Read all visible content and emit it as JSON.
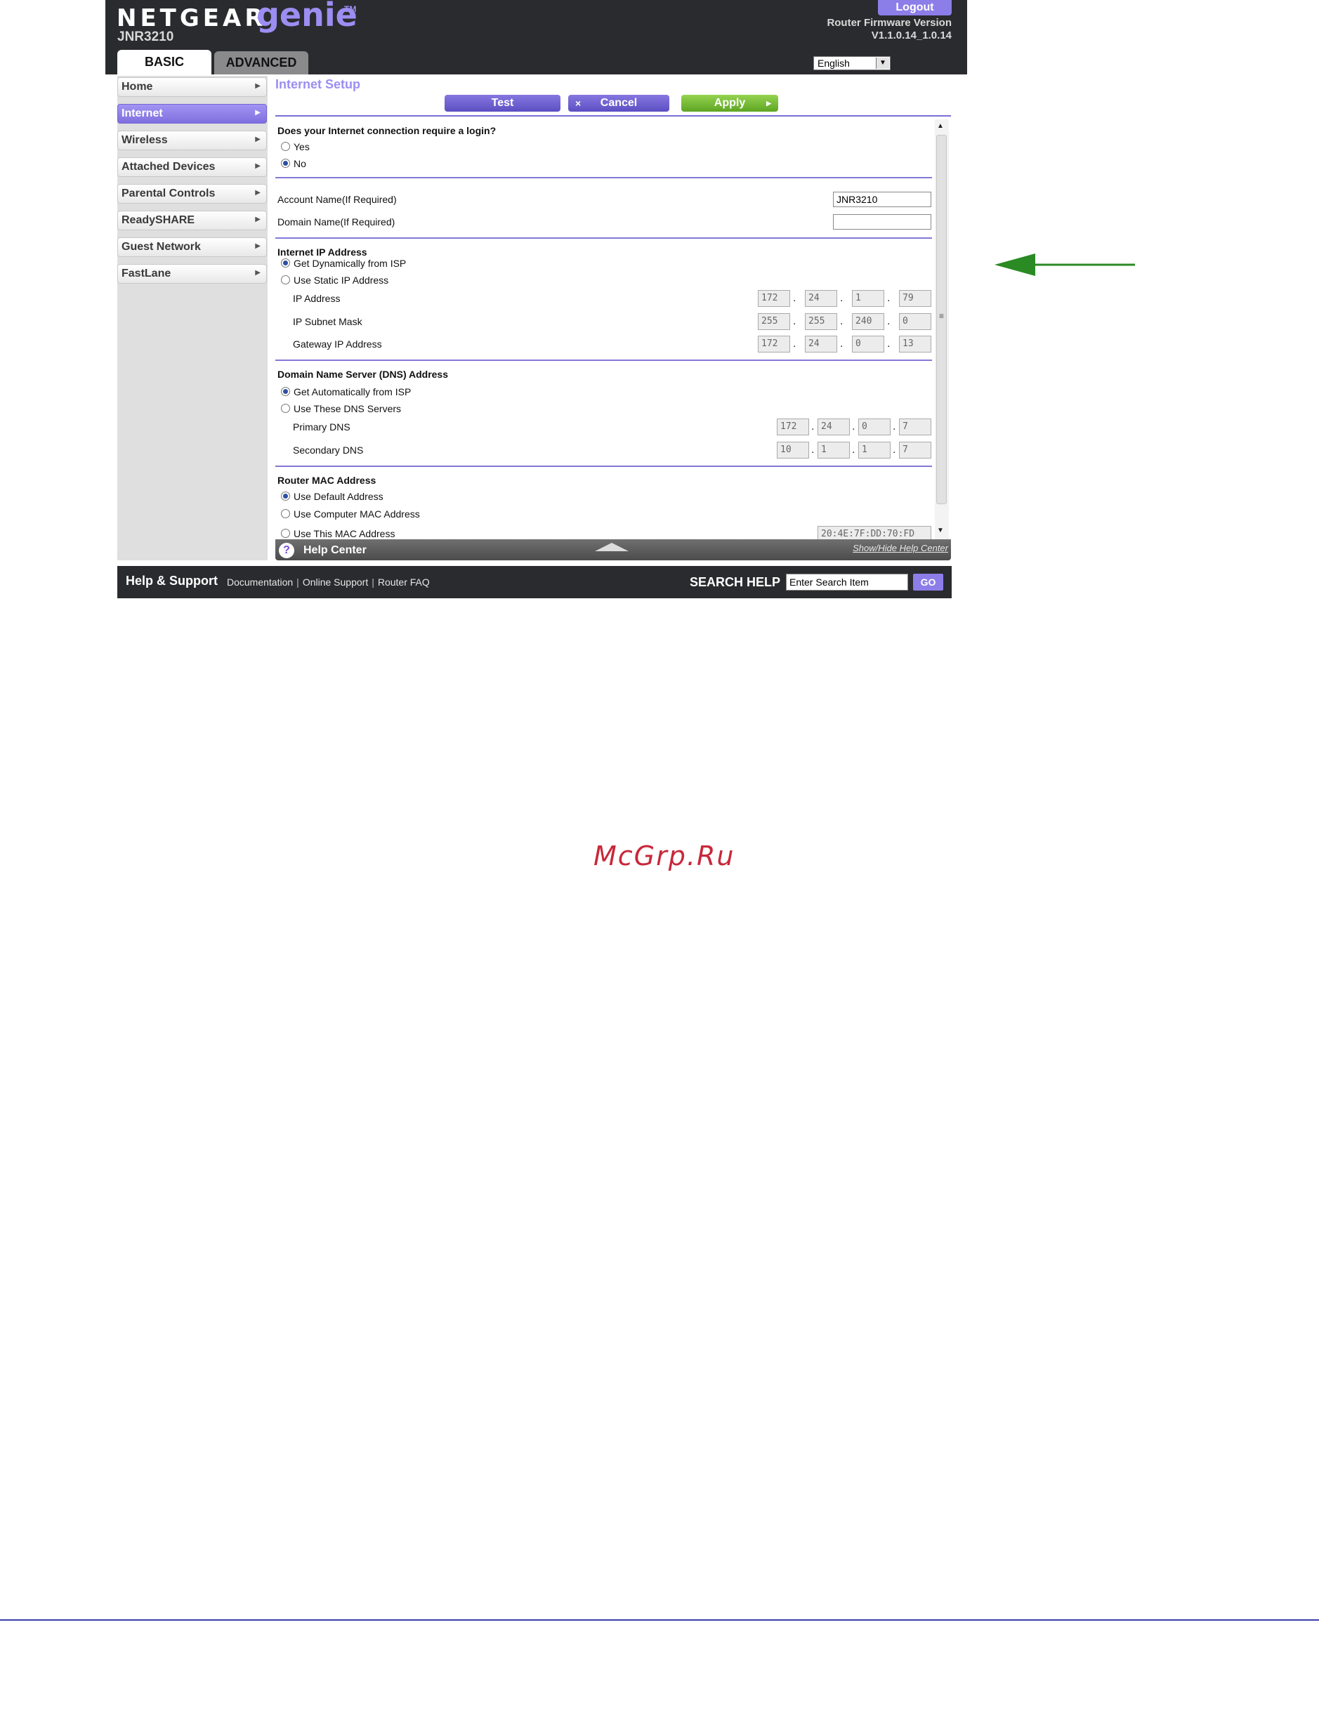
{
  "header": {
    "brand": "NETGEAR",
    "product": "genie",
    "tm": "TM",
    "model": "JNR3210",
    "logout_label": "Logout",
    "firmware_label": "Router Firmware Version",
    "firmware_version": "V1.1.0.14_1.0.14",
    "language": "English",
    "tabs": [
      {
        "label": "BASIC",
        "active": true
      },
      {
        "label": "ADVANCED",
        "active": false
      }
    ]
  },
  "sidebar": {
    "items": [
      {
        "label": "Home",
        "active": false
      },
      {
        "label": "Internet",
        "active": true
      },
      {
        "label": "Wireless",
        "active": false
      },
      {
        "label": "Attached Devices",
        "active": false
      },
      {
        "label": "Parental Controls",
        "active": false
      },
      {
        "label": "ReadySHARE",
        "active": false
      },
      {
        "label": "Guest Network",
        "active": false
      },
      {
        "label": "FastLane",
        "active": false
      }
    ]
  },
  "main": {
    "title": "Internet Setup",
    "buttons": {
      "test": "Test",
      "cancel": "Cancel",
      "apply": "Apply",
      "cancel_icon": "×",
      "apply_icon": "▶"
    },
    "login": {
      "question": "Does your Internet connection require a login?",
      "yes": "Yes",
      "no": "No",
      "selected": "No"
    },
    "account": {
      "account_label": "Account Name(If Required)",
      "account_value": "JNR3210",
      "domain_label": "Domain Name(If Required)",
      "domain_value": ""
    },
    "internet_ip": {
      "heading": "Internet IP Address",
      "opt_dynamic": "Get Dynamically from ISP",
      "opt_static": "Use Static IP Address",
      "selected": "Get Dynamically from ISP",
      "ip_label": "IP Address",
      "ip": [
        "172",
        "24",
        "1",
        "79"
      ],
      "mask_label": "IP Subnet Mask",
      "mask": [
        "255",
        "255",
        "240",
        "0"
      ],
      "gateway_label": "Gateway IP Address",
      "gateway": [
        "172",
        "24",
        "0",
        "13"
      ]
    },
    "dns": {
      "heading": "Domain Name Server (DNS) Address",
      "opt_auto": "Get Automatically from ISP",
      "opt_these": "Use These DNS Servers",
      "selected": "Get Automatically from ISP",
      "primary_label": "Primary DNS",
      "primary": [
        "172",
        "24",
        "0",
        "7"
      ],
      "secondary_label": "Secondary DNS",
      "secondary": [
        "10",
        "1",
        "1",
        "7"
      ]
    },
    "mac": {
      "heading": "Router MAC Address",
      "opt_default": "Use Default Address",
      "opt_computer": "Use Computer MAC Address",
      "opt_this": "Use This MAC Address",
      "selected": "Use Default Address",
      "value": "20:4E:7F:DD:70:FD"
    },
    "help_center": {
      "label": "Help Center",
      "toggle": "Show/Hide Help Center"
    }
  },
  "footer": {
    "title": "Help & Support",
    "links": [
      "Documentation",
      "Online Support",
      "Router FAQ"
    ],
    "search_label": "SEARCH HELP",
    "search_placeholder": "Enter Search Item",
    "go_label": "GO"
  },
  "annotations": {
    "arrow_color": "#2a8a24",
    "watermark": "McGrp.Ru"
  }
}
